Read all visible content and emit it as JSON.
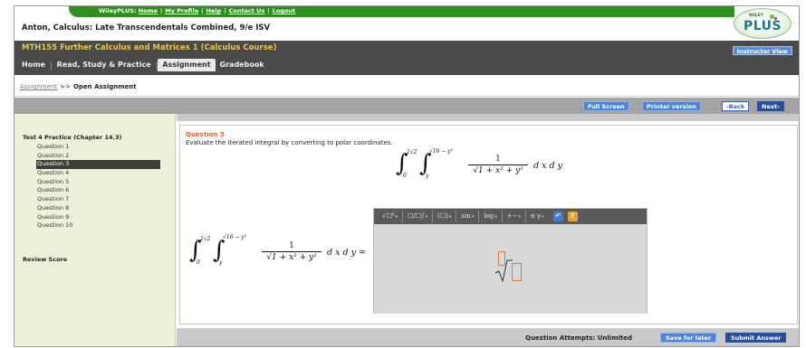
{
  "header": {
    "brand": "WileyPLUS:",
    "links": [
      "Home",
      "My Profile",
      "Help",
      "Contact Us",
      "Logout"
    ],
    "book_title": "Anton, Calculus: Late Transcendentals Combined, 9/e ISV",
    "logo": {
      "wiley": "WILEY",
      "plus": "PLUS"
    }
  },
  "course": {
    "title": "MTH155 Further Calculus and Matrices 1 (Calculus Course)",
    "instructor_view": "Instructor View",
    "tabs": [
      "Home",
      "Read, Study & Practice",
      "Assignment",
      "Gradebook"
    ],
    "active_tab": "Assignment"
  },
  "breadcrumb": {
    "link": "Assignment",
    "separator": ">>",
    "current": "Open Assignment"
  },
  "toolbar": {
    "full_screen": "Full Screen",
    "printer_version": "Printer version",
    "back": "‹Back",
    "next": "Next›"
  },
  "sidebar": {
    "heading": "Test 4 Practice (Chapter 14.3)",
    "questions": [
      "Question 1",
      "Question 2",
      "Question 3",
      "Question 4",
      "Question 5",
      "Question 6",
      "Question 7",
      "Question 8",
      "Question 9",
      "Question 10"
    ],
    "active_index": 2,
    "review": "Review Score"
  },
  "question": {
    "title": "Question 3",
    "prompt": "Evaluate the iterated integral by converting to polar coordinates.",
    "integral": {
      "outer_upper": "2√2",
      "outer_lower": "0",
      "inner_upper": "√16 − y²",
      "inner_lower": "y",
      "numerator": "1",
      "denominator": "√1 + x² + y²",
      "differential": "d x d y",
      "equals": "="
    }
  },
  "editor": {
    "tools": [
      "√☐⁰",
      "☐/☐∫",
      "(☐)",
      "sin",
      "log",
      "+−",
      "α γ"
    ],
    "undo_icon": "↶",
    "help_icon": "?"
  },
  "footer": {
    "attempts": "Question Attempts: Unlimited",
    "save_for_later": "Save for later",
    "submit_answer": "Submit Answer"
  },
  "colors": {
    "brand_green": "#2f8f1f",
    "course_bar": "#4a4a4a",
    "course_title": "#e6c64e",
    "button_blue": "#4f86d1",
    "question_title": "#e8621e",
    "sidebar_bg": "#ecf2d8"
  }
}
